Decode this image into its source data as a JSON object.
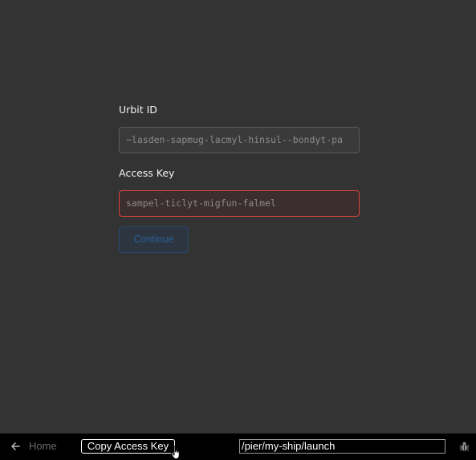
{
  "login_form": {
    "urbit_id_label": "Urbit ID",
    "urbit_id_value": "~lasden-sapmug-lacmyl-hinsul--bondyt-pa",
    "access_key_label": "Access Key",
    "access_key_value": "sampel-ticlyt-migfun-falmel",
    "continue_label": "Continue",
    "access_key_state": "error",
    "continue_state": "disabled"
  },
  "bottom_bar": {
    "back_icon": "arrow-left-icon",
    "home_label": "Home",
    "copy_button_label": "Copy Access Key",
    "path_value": "/pier/my-ship/launch",
    "bug_icon": "bug-icon"
  },
  "colors": {
    "background": "#333333",
    "error_border": "#d9433a",
    "continue_text": "#2a5f96",
    "bottom_bar": "#000000"
  }
}
